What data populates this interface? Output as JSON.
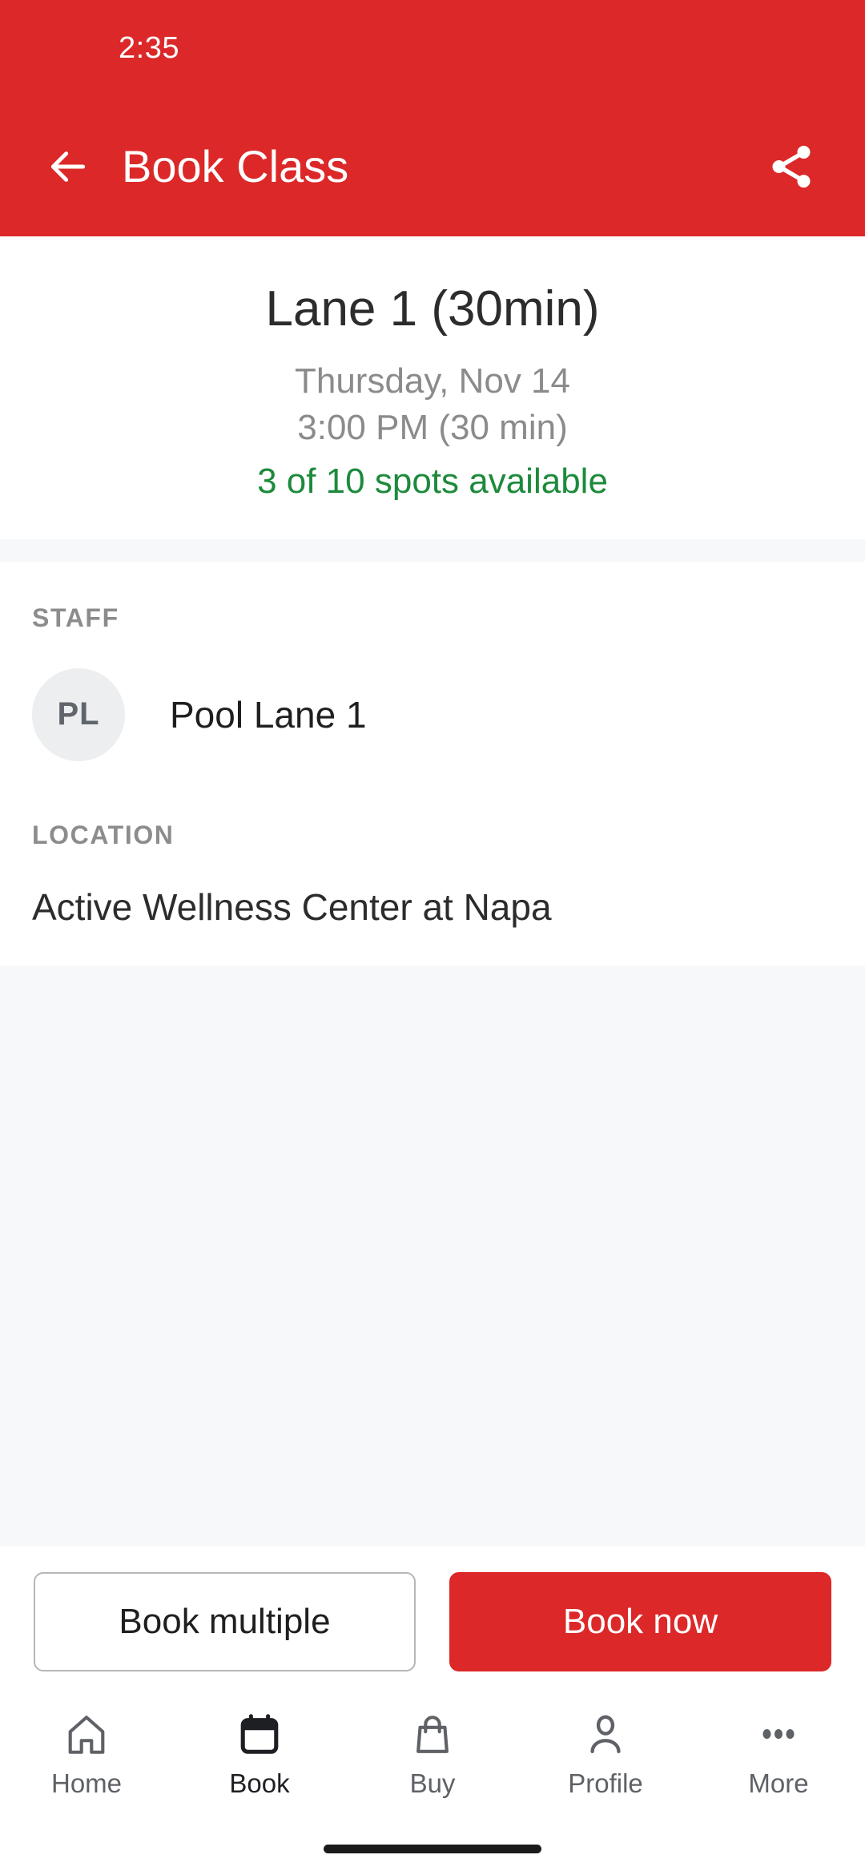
{
  "status_bar": {
    "time": "2:35"
  },
  "appbar": {
    "title": "Book Class",
    "back_icon": "arrow-left-icon",
    "share_icon": "share-icon",
    "background": "#dc2828"
  },
  "hero": {
    "title": "Lane 1 (30min)",
    "date": "Thursday, Nov 14",
    "time": "3:00 PM (30 min)",
    "availability": "3 of 10 spots available",
    "availability_color": "#1d8a3c"
  },
  "staff_section": {
    "label": "STAFF",
    "avatar_initials": "PL",
    "name": "Pool Lane 1"
  },
  "location_section": {
    "label": "LOCATION",
    "name": "Active Wellness Center at Napa"
  },
  "actions": {
    "secondary_label": "Book multiple",
    "primary_label": "Book now",
    "primary_color": "#dc2828"
  },
  "tabbar": {
    "items": [
      {
        "label": "Home",
        "icon": "home-icon",
        "active": false
      },
      {
        "label": "Book",
        "icon": "calendar-icon",
        "active": true
      },
      {
        "label": "Buy",
        "icon": "shopping-bag-icon",
        "active": false
      },
      {
        "label": "Profile",
        "icon": "person-icon",
        "active": false
      },
      {
        "label": "More",
        "icon": "ellipsis-icon",
        "active": false
      }
    ]
  }
}
